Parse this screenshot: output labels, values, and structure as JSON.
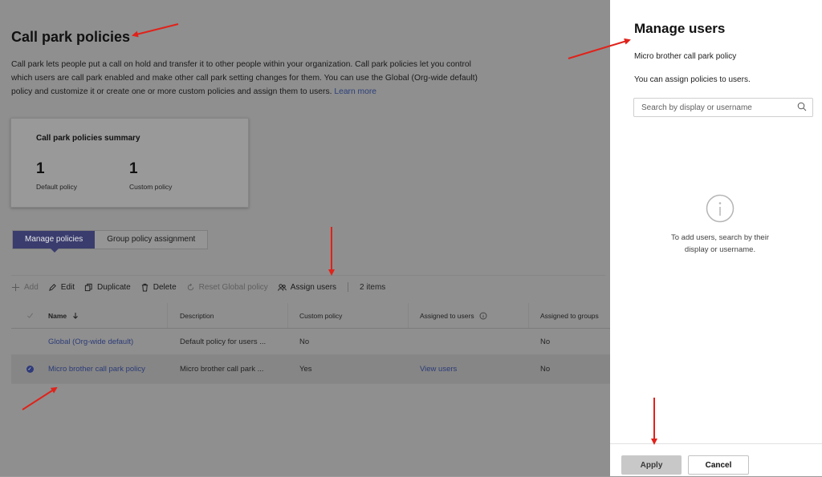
{
  "page": {
    "title": "Call park policies",
    "intro": "Call park lets people put a call on hold and transfer it to other people within your organization. Call park policies let you control which users are call park enabled and make other call park setting changes for them. You can use the Global (Org-wide default) policy and customize it or create one or more custom policies and assign them to users.",
    "learn_more": "Learn more"
  },
  "summary": {
    "heading": "Call park policies summary",
    "default_count": "1",
    "default_label": "Default policy",
    "custom_count": "1",
    "custom_label": "Custom policy"
  },
  "tabs": [
    {
      "label": "Manage policies",
      "active": true
    },
    {
      "label": "Group policy assignment",
      "active": false
    }
  ],
  "toolbar": {
    "add": "Add",
    "edit": "Edit",
    "duplicate": "Duplicate",
    "delete": "Delete",
    "reset": "Reset Global policy",
    "assign": "Assign users",
    "count": "2 items"
  },
  "table": {
    "headers": [
      "Name",
      "Description",
      "Custom policy",
      "Assigned to users",
      "Assigned to groups"
    ],
    "rows": [
      {
        "name": "Global (Org-wide default)",
        "description": "Default policy for users ...",
        "custom": "No",
        "users": "",
        "groups": "No",
        "selected": false
      },
      {
        "name": "Micro brother call park policy",
        "description": "Micro brother call park ...",
        "custom": "Yes",
        "users": "View users",
        "groups": "No",
        "selected": true
      }
    ]
  },
  "panel": {
    "title": "Manage users",
    "policy": "Micro brother call park policy",
    "description": "You can assign policies to users.",
    "search_placeholder": "Search by display or username",
    "empty_message": "To add users, search by their display or username.",
    "apply": "Apply",
    "cancel": "Cancel"
  },
  "colors": {
    "accent": "#3a3c6e",
    "annotation_arrow": "#e0221a",
    "overlay": "#8f8f8f"
  },
  "icons": [
    "add-icon",
    "edit-icon",
    "duplicate-icon",
    "delete-icon",
    "reset-icon",
    "assign-users-icon",
    "sort-down-icon",
    "info-circle-icon",
    "search-icon",
    "check-circle-icon"
  ]
}
